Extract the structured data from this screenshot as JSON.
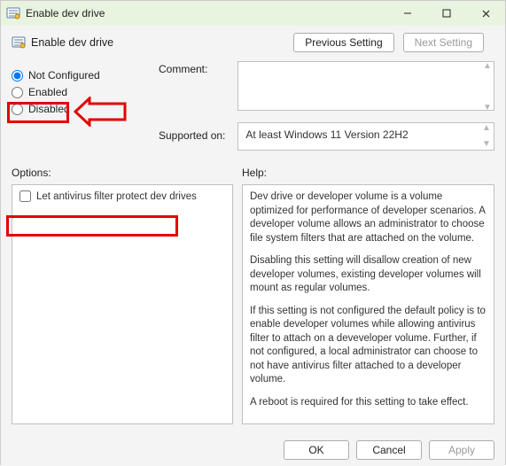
{
  "window": {
    "title": "Enable dev drive"
  },
  "subheader": {
    "title": "Enable dev drive"
  },
  "nav": {
    "previous": "Previous Setting",
    "next": "Next Setting"
  },
  "radios": {
    "not_configured": "Not Configured",
    "enabled": "Enabled",
    "disabled": "Disabled"
  },
  "labels": {
    "comment": "Comment:",
    "supported": "Supported on:",
    "options": "Options:",
    "help": "Help:"
  },
  "comment_value": "",
  "supported_value": "At least Windows 11 Version 22H2",
  "options": {
    "checkbox_label": "Let antivirus filter protect dev drives"
  },
  "help_text": {
    "p1": "Dev drive or developer volume is a volume optimized for performance of developer scenarios. A developer volume allows an administrator to choose file system filters that are attached on the volume.",
    "p2": "Disabling this setting will disallow creation of new developer volumes, existing developer volumes will mount as regular volumes.",
    "p3": "If this setting is not configured the default policy is to enable developer volumes while allowing antivirus filter to attach on a deveveloper volume.  Further, if not configured, a local administrator can choose to not have antivirus filter attached to a developer volume.",
    "p4": "A reboot is required for this setting to take effect."
  },
  "buttons": {
    "ok": "OK",
    "cancel": "Cancel",
    "apply": "Apply"
  }
}
